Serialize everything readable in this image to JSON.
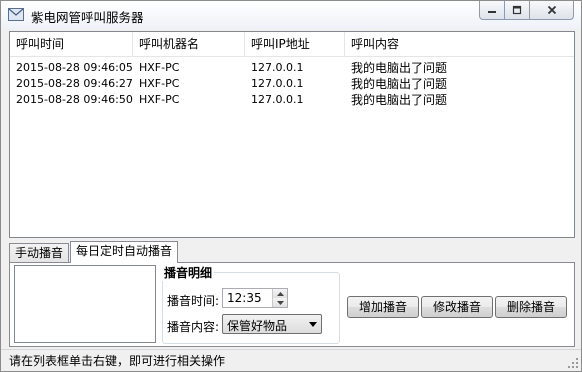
{
  "window": {
    "title": "紫电网管呼叫服务器"
  },
  "list": {
    "columns": [
      "呼叫时间",
      "呼叫机器名",
      "呼叫IP地址",
      "呼叫内容"
    ],
    "rows": [
      [
        "2015-08-28 09:46:05",
        "HXF-PC",
        "127.0.0.1",
        "我的电脑出了问题"
      ],
      [
        "2015-08-28 09:46:27",
        "HXF-PC",
        "127.0.0.1",
        "我的电脑出了问题"
      ],
      [
        "2015-08-28 09:46:50",
        "HXF-PC",
        "127.0.0.1",
        "我的电脑出了问题"
      ]
    ]
  },
  "tabs": [
    {
      "label": "手动播音",
      "active": false
    },
    {
      "label": "每日定时自动播音",
      "active": true
    }
  ],
  "panel": {
    "group_title": "播音明细",
    "time_label": "播音时间:",
    "time_value": "12:35",
    "content_label": "播音内容:",
    "content_value": "保管好物品",
    "buttons": {
      "add": "增加播音",
      "modify": "修改播音",
      "delete": "删除播音"
    }
  },
  "status": {
    "text": "请在列表框单击右键，即可进行相关操作"
  },
  "icons": {
    "app": "mail-envelope-icon",
    "minimize": "minimize-icon",
    "maximize": "maximize-icon",
    "close": "close-icon",
    "spin_up": "arrow-up-icon",
    "spin_down": "arrow-down-icon",
    "dropdown": "chevron-down-icon",
    "grip": "resize-grip-icon"
  }
}
